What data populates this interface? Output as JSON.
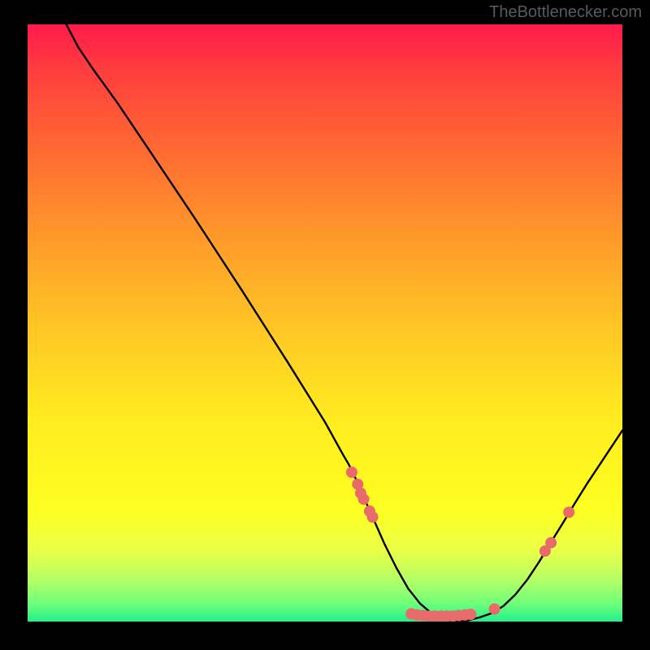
{
  "watermark": "TheBottlenecker.com",
  "chart_data": {
    "type": "line",
    "title": "",
    "xlabel": "",
    "ylabel": "",
    "xlim": [
      0,
      100
    ],
    "ylim": [
      0,
      100
    ],
    "curve": [
      {
        "x": 6.5,
        "y": 100
      },
      {
        "x": 8.5,
        "y": 96.2
      },
      {
        "x": 11,
        "y": 92.5
      },
      {
        "x": 15,
        "y": 87
      },
      {
        "x": 20,
        "y": 79.6
      },
      {
        "x": 28,
        "y": 67.7
      },
      {
        "x": 36,
        "y": 55.5
      },
      {
        "x": 44,
        "y": 43
      },
      {
        "x": 50,
        "y": 33.4
      },
      {
        "x": 53,
        "y": 28
      },
      {
        "x": 54,
        "y": 26.3
      },
      {
        "x": 55,
        "y": 24.3
      },
      {
        "x": 56,
        "y": 22
      },
      {
        "x": 58,
        "y": 17.5
      },
      {
        "x": 60,
        "y": 13
      },
      {
        "x": 62,
        "y": 9
      },
      {
        "x": 64,
        "y": 5.5
      },
      {
        "x": 66,
        "y": 3
      },
      {
        "x": 68,
        "y": 1.3
      },
      {
        "x": 70,
        "y": 0.3
      },
      {
        "x": 72,
        "y": 0
      },
      {
        "x": 74,
        "y": 0.2
      },
      {
        "x": 76,
        "y": 0.7
      },
      {
        "x": 78,
        "y": 1.4
      },
      {
        "x": 80,
        "y": 2.6
      },
      {
        "x": 82,
        "y": 4.5
      },
      {
        "x": 84,
        "y": 7
      },
      {
        "x": 86,
        "y": 10
      },
      {
        "x": 88,
        "y": 13.3
      },
      {
        "x": 90,
        "y": 16.5
      },
      {
        "x": 92,
        "y": 19.8
      },
      {
        "x": 94,
        "y": 23
      },
      {
        "x": 96,
        "y": 26
      },
      {
        "x": 98,
        "y": 29
      },
      {
        "x": 100,
        "y": 32
      }
    ],
    "dots": [
      {
        "x": 54.5,
        "y": 25
      },
      {
        "x": 55.5,
        "y": 23
      },
      {
        "x": 56,
        "y": 21.5
      },
      {
        "x": 56.5,
        "y": 20.5
      },
      {
        "x": 57.5,
        "y": 18.5
      },
      {
        "x": 58,
        "y": 17.5
      },
      {
        "x": 64.5,
        "y": 1.3
      },
      {
        "x": 65.5,
        "y": 1.1
      },
      {
        "x": 66.5,
        "y": 1
      },
      {
        "x": 67.5,
        "y": 0.9
      },
      {
        "x": 68.5,
        "y": 0.9
      },
      {
        "x": 69.5,
        "y": 0.9
      },
      {
        "x": 70.5,
        "y": 0.9
      },
      {
        "x": 71.5,
        "y": 0.9
      },
      {
        "x": 72.5,
        "y": 1
      },
      {
        "x": 73.5,
        "y": 1.1
      },
      {
        "x": 74.5,
        "y": 1.2
      },
      {
        "x": 78.5,
        "y": 2.1
      },
      {
        "x": 87,
        "y": 11.8
      },
      {
        "x": 88,
        "y": 13.2
      },
      {
        "x": 91,
        "y": 18.3
      }
    ],
    "dot_color": "#e86a6a",
    "dot_radius_px": 7
  }
}
